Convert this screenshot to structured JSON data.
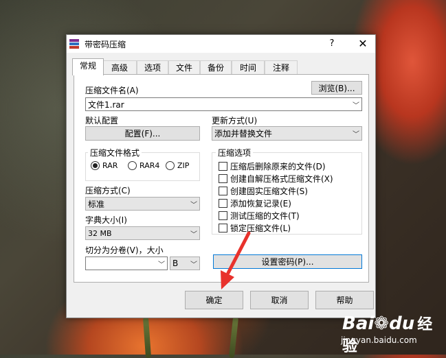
{
  "dialog": {
    "title": "带密码压缩",
    "help_label": "?",
    "close_label": "✕",
    "tabs": [
      {
        "label": "常规",
        "active": true
      },
      {
        "label": "高级"
      },
      {
        "label": "选项"
      },
      {
        "label": "文件"
      },
      {
        "label": "备份"
      },
      {
        "label": "时间"
      },
      {
        "label": "注释"
      }
    ]
  },
  "general": {
    "archive_name_label": "压缩文件名(A)",
    "browse_button": "浏览(B)...",
    "archive_name_value": "文件1.rar",
    "default_profile_label": "默认配置",
    "profiles_button": "配置(F)...",
    "update_mode_label": "更新方式(U)",
    "update_mode_value": "添加并替换文件",
    "format_group_label": "压缩文件格式",
    "formats": [
      {
        "label": "RAR",
        "selected": true
      },
      {
        "label": "RAR4",
        "selected": false
      },
      {
        "label": "ZIP",
        "selected": false
      }
    ],
    "method_label": "压缩方式(C)",
    "method_value": "标准",
    "dict_label": "字典大小(I)",
    "dict_value": "32 MB",
    "split_label": "切分为分卷(V)，大小",
    "split_value": "",
    "split_unit": "B",
    "options_group_label": "压缩选项",
    "options": [
      {
        "label": "压缩后删除原来的文件(D)",
        "checked": false
      },
      {
        "label": "创建自解压格式压缩文件(X)",
        "checked": false
      },
      {
        "label": "创建固实压缩文件(S)",
        "checked": false
      },
      {
        "label": "添加恢复记录(E)",
        "checked": false
      },
      {
        "label": "测试压缩的文件(T)",
        "checked": false
      },
      {
        "label": "锁定压缩文件(L)",
        "checked": false
      }
    ],
    "set_password_button": "设置密码(P)..."
  },
  "footer": {
    "ok_button": "确定",
    "cancel_button": "取消",
    "help_button": "帮助"
  },
  "watermark": {
    "logo_text": "Bai",
    "logo_text_2": "du",
    "brand_suffix": "经验",
    "url": "jingyan.baidu.com"
  },
  "colors": {
    "focus_border": "#0078d7",
    "annotation_arrow": "#e8322c"
  }
}
